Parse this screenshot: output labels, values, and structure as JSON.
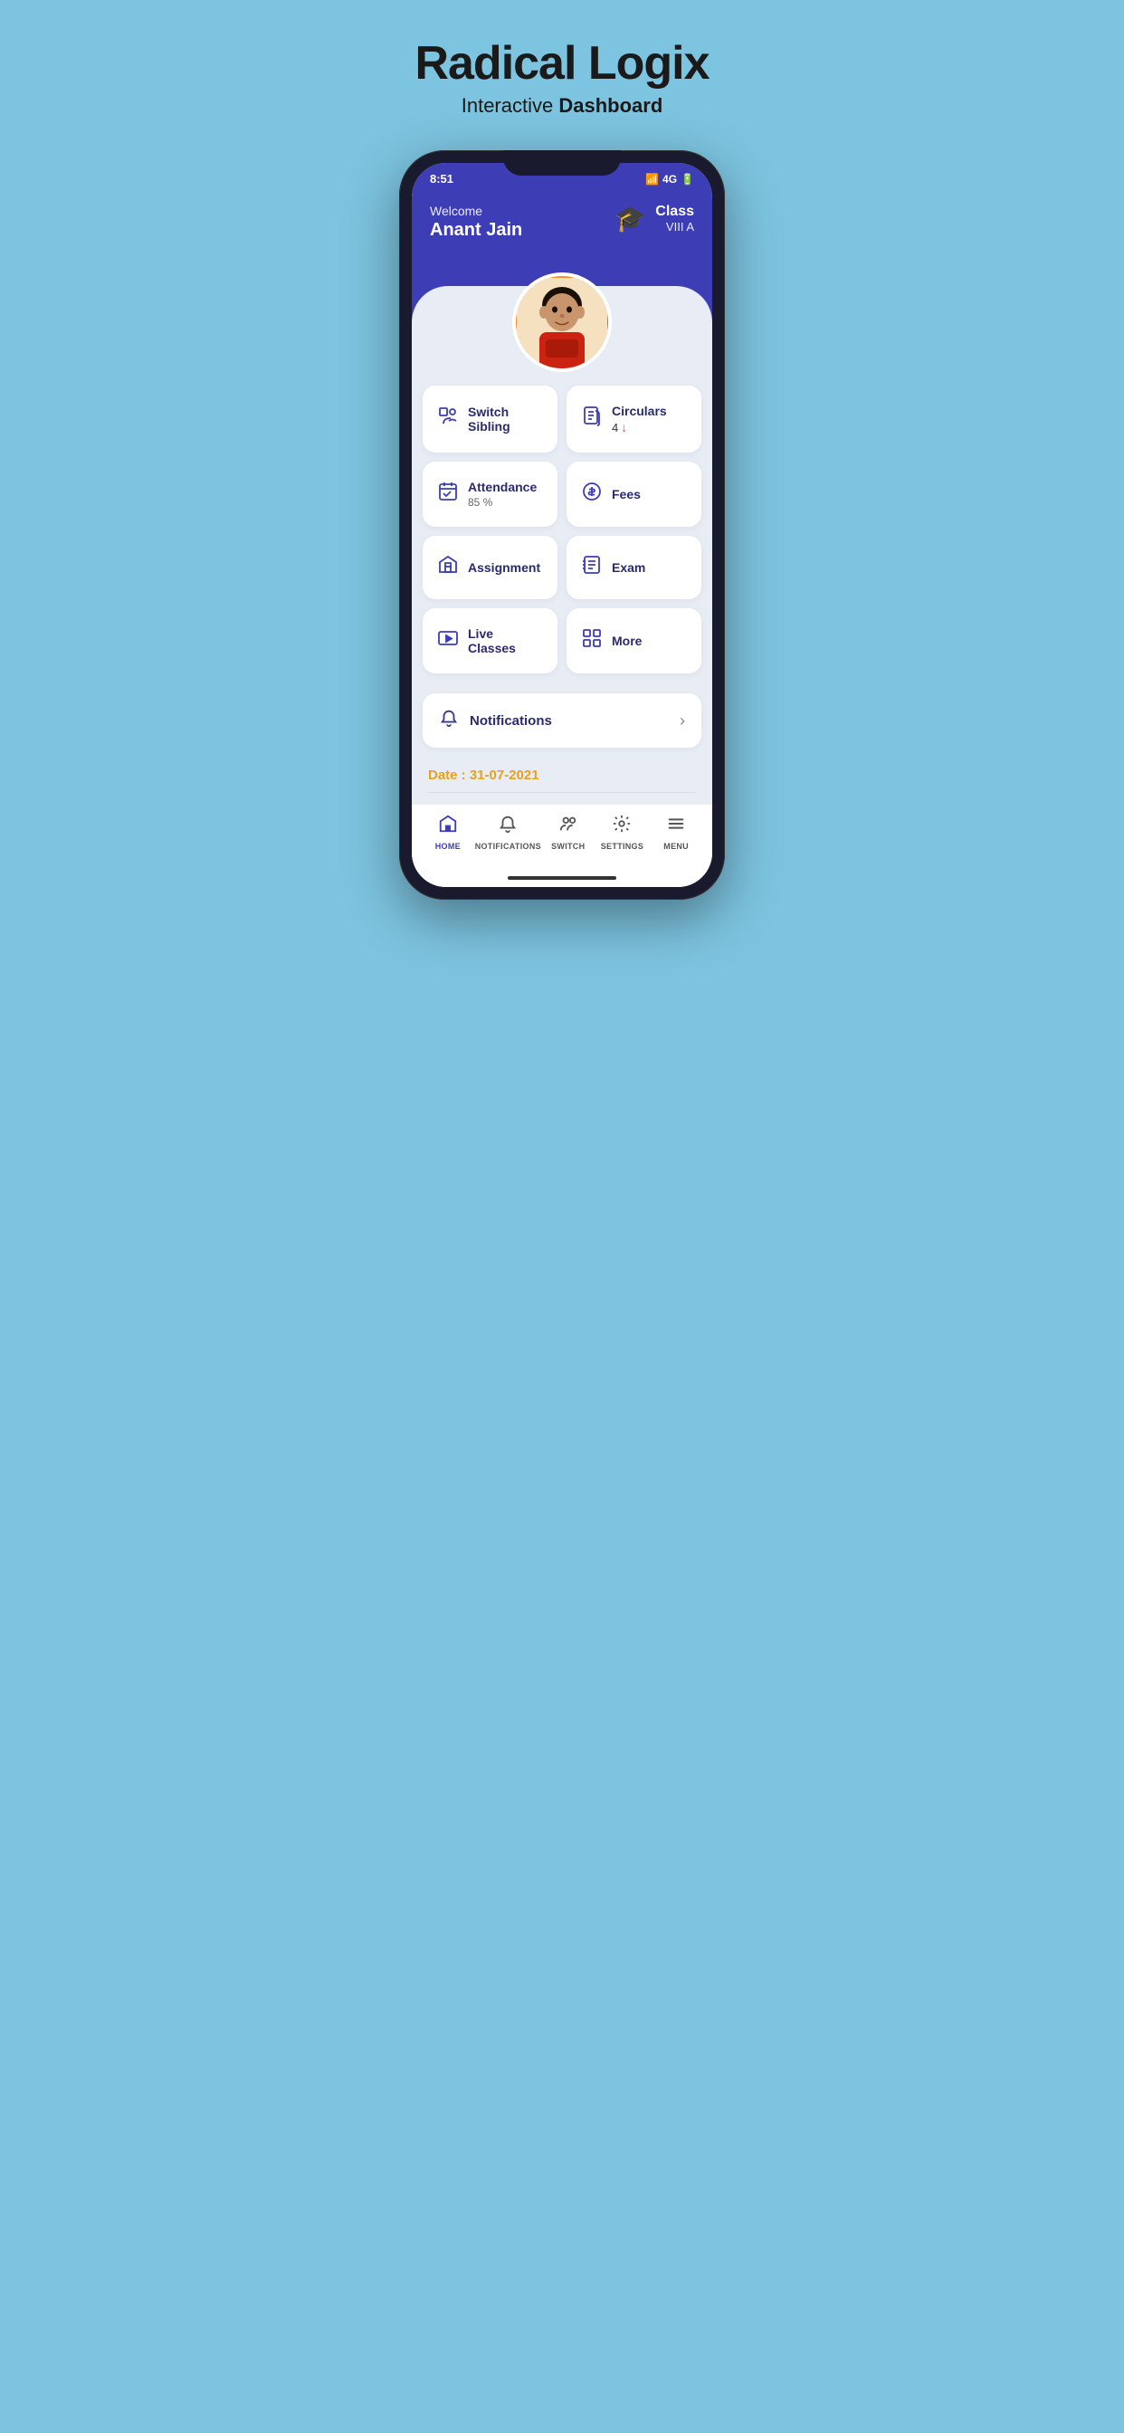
{
  "page": {
    "bg_title": "Radical Logix",
    "bg_subtitle_plain": "Interactive ",
    "bg_subtitle_bold": "Dashboard"
  },
  "status_bar": {
    "time": "8:51",
    "signal": "4G",
    "battery": "▓"
  },
  "header": {
    "welcome_label": "Welcome",
    "student_name": "Anant  Jain",
    "class_label": "Class",
    "class_value": "VIII A"
  },
  "grid": {
    "row1": [
      {
        "id": "switch-sibling",
        "icon": "🔍",
        "title": "Switch Sibling",
        "subtitle": ""
      },
      {
        "id": "circulars",
        "icon": "📋",
        "title": "Circulars",
        "count": "4",
        "has_count": true
      }
    ],
    "row2": [
      {
        "id": "attendance",
        "icon": "📅",
        "title": "Attendance",
        "subtitle": "85 %"
      },
      {
        "id": "fees",
        "icon": "💰",
        "title": "Fees",
        "subtitle": ""
      }
    ],
    "row3": [
      {
        "id": "assignment",
        "icon": "🏠",
        "title": "Assignment",
        "subtitle": ""
      },
      {
        "id": "exam",
        "icon": "📝",
        "title": "Exam",
        "subtitle": ""
      }
    ],
    "row4": [
      {
        "id": "live-classes",
        "icon": "📺",
        "title": "Live Classes",
        "subtitle": ""
      },
      {
        "id": "more",
        "icon": "📋",
        "title": "More",
        "subtitle": ""
      }
    ]
  },
  "notifications": {
    "label": "Notifications",
    "arrow": "›"
  },
  "date": {
    "label": "Date : 31-07-2021"
  },
  "bottom_nav": {
    "items": [
      {
        "id": "home",
        "icon": "⌂",
        "label": "HOME",
        "active": true
      },
      {
        "id": "notifications",
        "icon": "🔔",
        "label": "NOTIFICATIONS",
        "active": false
      },
      {
        "id": "switch",
        "icon": "👥",
        "label": "SWITCH",
        "active": false
      },
      {
        "id": "settings",
        "icon": "⚙",
        "label": "SETTINGS",
        "active": false
      },
      {
        "id": "menu",
        "icon": "≡",
        "label": "MENU",
        "active": false
      }
    ]
  }
}
